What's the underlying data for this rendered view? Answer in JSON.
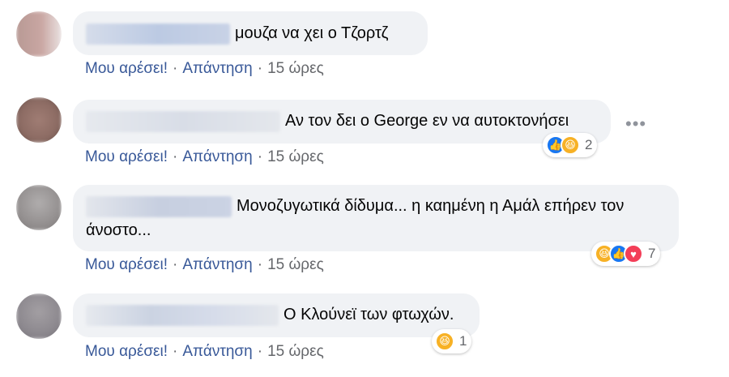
{
  "colors": {
    "bubble": "#f0f2f5",
    "link": "#385898",
    "meta": "#65676b",
    "like": "#1877f2",
    "haha": "#f7b125",
    "love": "#f33e58"
  },
  "comments": [
    {
      "author": "Α. Σπύρου Κιάπης",
      "text": "μουζα να χει ο Τζορτζ",
      "actions": {
        "like": "Μου αρέσει!",
        "reply": "Απάντηση",
        "sep": "·",
        "time": "15 ώρες"
      },
      "reactions": null
    },
    {
      "author": "",
      "text": "Αν τον δει ο George εν να αυτοκτονήσει",
      "actions": {
        "like": "Μου αρέσει!",
        "reply": "Απάντηση",
        "sep": "·",
        "time": "15 ώρες"
      },
      "reactions": {
        "icons": [
          "like-icon",
          "haha-icon"
        ],
        "count": "2"
      },
      "more_label": "•••"
    },
    {
      "author": "",
      "text_line1": "Μονοζυγωτικά δίδυμα... η καημένη η Αμάλ επήρεν τον",
      "text_line2": "άνοστο...",
      "actions": {
        "like": "Μου αρέσει!",
        "reply": "Απάντηση",
        "sep": "·",
        "time": "15 ώρες"
      },
      "reactions": {
        "icons": [
          "haha-icon",
          "like-icon",
          "love-icon"
        ],
        "count": "7"
      }
    },
    {
      "author": "",
      "text": "Ο Κλούνεϊ των φτωχών.",
      "actions": {
        "like": "Μου αρέσει!",
        "reply": "Απάντηση",
        "sep": "·",
        "time": "15 ώρες"
      },
      "reactions": {
        "icons": [
          "haha-icon"
        ],
        "count": "1"
      }
    }
  ]
}
